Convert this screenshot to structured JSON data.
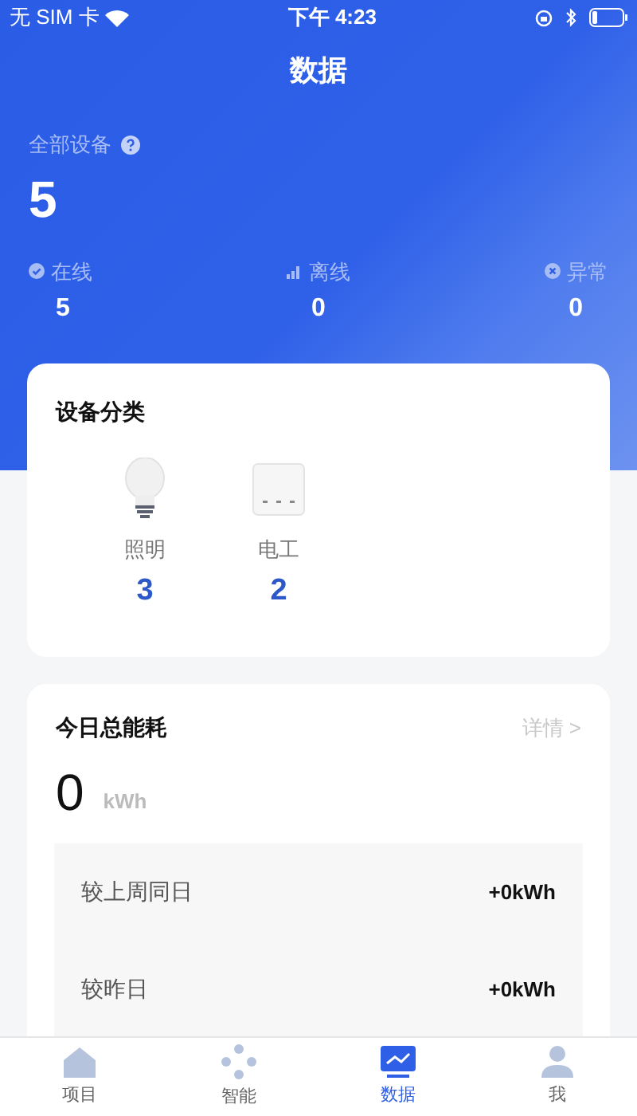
{
  "status_bar": {
    "carrier": "无 SIM 卡",
    "time": "下午 4:23"
  },
  "title": "数据",
  "summary": {
    "label": "全部设备",
    "total": "5",
    "stats": [
      {
        "kind": "online",
        "label": "在线",
        "value": "5"
      },
      {
        "kind": "offline",
        "label": "离线",
        "value": "0"
      },
      {
        "kind": "error",
        "label": "异常",
        "value": "0"
      }
    ]
  },
  "categories": {
    "title": "设备分类",
    "items": [
      {
        "kind": "light",
        "label": "照明",
        "count": "3"
      },
      {
        "kind": "electrical",
        "label": "电工",
        "count": "2"
      }
    ]
  },
  "energy": {
    "title": "今日总能耗",
    "link": "详情 >",
    "value": "0",
    "unit": "kWh",
    "comparisons": [
      {
        "label": "较上周同日",
        "value": "+0kWh"
      },
      {
        "label": "较昨日",
        "value": "+0kWh"
      }
    ]
  },
  "tab_bar": [
    {
      "kind": "home",
      "label": "项目",
      "selected": false
    },
    {
      "kind": "smart",
      "label": "智能",
      "selected": false
    },
    {
      "kind": "data",
      "label": "数据",
      "selected": true
    },
    {
      "kind": "me",
      "label": "我",
      "selected": false
    }
  ]
}
